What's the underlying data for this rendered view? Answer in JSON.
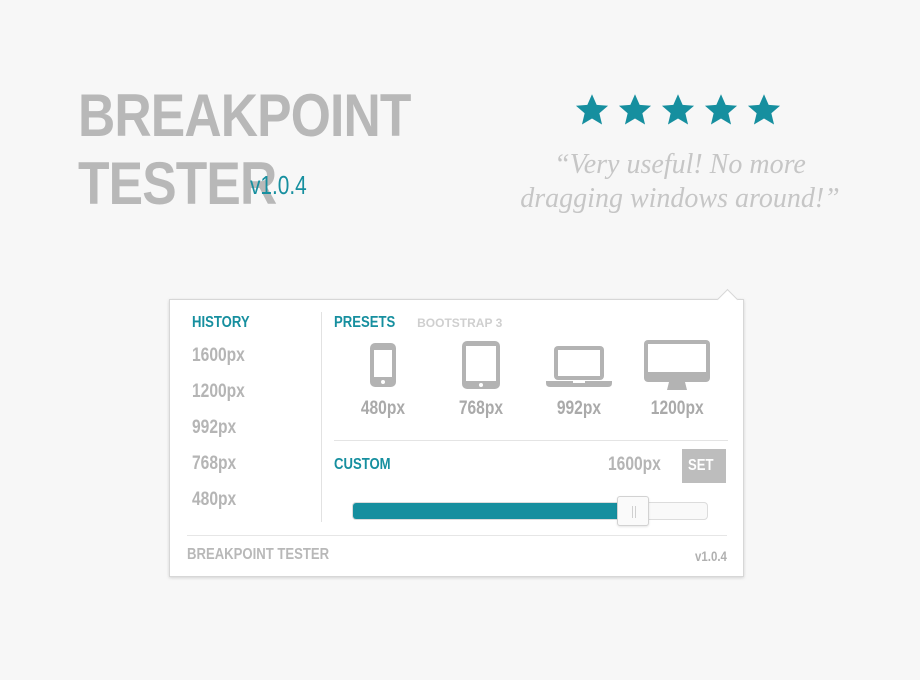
{
  "hero": {
    "title_line1": "BREAKPOINT",
    "title_line2": "TESTER",
    "version": "v1.0.4"
  },
  "rating": {
    "stars": 5,
    "star_color": "#168f9f",
    "quote_line1": "“Very useful! No more",
    "quote_line2": "dragging windows around!”"
  },
  "panel": {
    "history": {
      "heading": "HISTORY",
      "items": [
        "1600px",
        "1200px",
        "992px",
        "768px",
        "480px"
      ]
    },
    "presets": {
      "heading": "PRESETS",
      "subheading": "BOOTSTRAP 3",
      "devices": [
        {
          "icon": "phone-icon",
          "label": "480px"
        },
        {
          "icon": "tablet-icon",
          "label": "768px"
        },
        {
          "icon": "laptop-icon",
          "label": "992px"
        },
        {
          "icon": "desktop-icon",
          "label": "1200px"
        }
      ]
    },
    "custom": {
      "heading": "CUSTOM",
      "value": "1600px",
      "set_label": "SET",
      "slider_fraction": 0.79
    },
    "footer": {
      "title": "BREAKPOINT TESTER",
      "version": "v1.0.4"
    }
  },
  "colors": {
    "accent": "#168f9f",
    "muted_text": "#b5b5b5",
    "icon": "#b3b3b3"
  }
}
